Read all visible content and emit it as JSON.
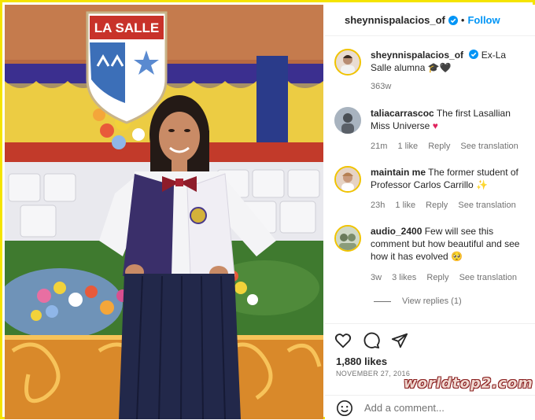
{
  "photo": {
    "banner_text": "LA SALLE"
  },
  "header": {
    "username": "sheynnispalacios_of",
    "separator": "•",
    "follow_label": "Follow"
  },
  "caption": {
    "username": "sheynnispalacios_of",
    "text": "Ex-La Salle alumna",
    "time": "363w"
  },
  "comments": [
    {
      "username": "taliacarrascoc",
      "text": "The first Lasallian Miss Universe",
      "time": "21m",
      "likes": "1 like",
      "reply": "Reply",
      "translate": "See translation"
    },
    {
      "username": "maintain me",
      "text": "The former student of Professor Carlos Carrillo",
      "time": "23h",
      "likes": "1 like",
      "reply": "Reply",
      "translate": "See translation"
    },
    {
      "username": "audio_2400",
      "text": "Few will see this comment but how beautiful and see how it has evolved",
      "time": "3w",
      "likes": "3 likes",
      "reply": "Reply",
      "translate": "See translation",
      "view_replies": "View replies (1)"
    }
  ],
  "post": {
    "likes": "1,880 likes",
    "date": "NOVEMBER 27, 2016",
    "add_comment_placeholder": "Add a comment..."
  },
  "watermark": "worldtop2.com",
  "colors": {
    "accent": "#0095f6",
    "border": "#f5e400",
    "muted": "#737373"
  }
}
